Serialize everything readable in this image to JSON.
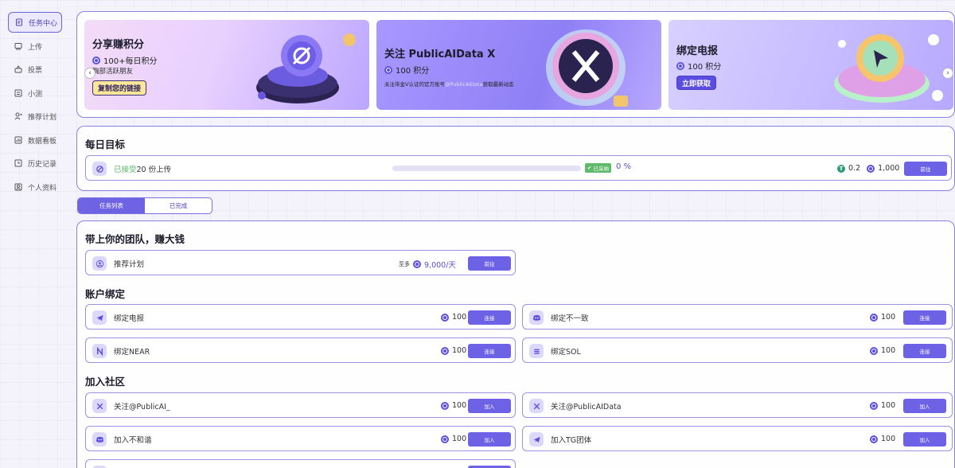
{
  "sidebar": {
    "items": [
      {
        "label": "任务中心",
        "icon": "task-center-icon",
        "active": true
      },
      {
        "label": "上传",
        "icon": "upload-icon"
      },
      {
        "label": "投票",
        "icon": "vote-icon"
      },
      {
        "label": "小测",
        "icon": "quiz-icon"
      },
      {
        "label": "推荐计划",
        "icon": "referral-icon"
      },
      {
        "label": "数据看板",
        "icon": "dashboard-icon"
      },
      {
        "label": "历史记录",
        "icon": "history-icon"
      },
      {
        "label": "个人资料",
        "icon": "profile-icon"
      }
    ]
  },
  "banners": [
    {
      "title": "分享赚积分",
      "points": "100+每日积分",
      "subtitle": "胸部活跃朋友",
      "button": "复制您的链接"
    },
    {
      "title": "关注 PublicAIData X",
      "points": "100 积分",
      "subtitle_prefix": "关注带金V认证的官方账号",
      "subtitle_handle": "@PublicAIData",
      "subtitle_suffix": "获取最新动态"
    },
    {
      "title": "绑定电报",
      "points": "100 积分",
      "button": "立即获取"
    }
  ],
  "daily": {
    "title": "每日目标",
    "task": {
      "accepted": "已接受",
      "label": "20 份上传",
      "progress_percent": 0,
      "status": "已采纳",
      "percent_text": "0 %",
      "token_amount": "0.2",
      "points": "1,000",
      "button": "前往"
    }
  },
  "tabs": [
    {
      "label": "任务列表",
      "active": true
    },
    {
      "label": "已完成",
      "active": false
    }
  ],
  "sections": {
    "team": {
      "title": "带上你的团队，赚大钱",
      "task": {
        "label": "推荐计划",
        "prefix": "至多",
        "reward": "9,000/天",
        "button": "前往"
      }
    },
    "binding": {
      "title": "账户绑定",
      "tasks": [
        {
          "label": "绑定电报",
          "reward": "100",
          "button": "连接",
          "icon": "telegram-icon"
        },
        {
          "label": "绑定不一致",
          "reward": "100",
          "button": "连接",
          "icon": "discord-icon"
        },
        {
          "label": "绑定NEAR",
          "reward": "100",
          "button": "连接",
          "icon": "near-icon"
        },
        {
          "label": "绑定SOL",
          "reward": "100",
          "button": "连接",
          "icon": "solana-icon"
        }
      ]
    },
    "community": {
      "title": "加入社区",
      "tasks": [
        {
          "label": "关注@PublicAI_",
          "reward": "100",
          "button": "加入",
          "icon": "x-icon"
        },
        {
          "label": "关注@PublicAIData",
          "reward": "100",
          "button": "加入",
          "icon": "x-icon"
        },
        {
          "label": "加入不和谐",
          "reward": "100",
          "button": "加入",
          "icon": "discord-icon"
        },
        {
          "label": "加入TG团体",
          "reward": "100",
          "button": "加入",
          "icon": "telegram-icon"
        }
      ]
    }
  },
  "colors": {
    "accent": "#6e63e3",
    "brand": "#5c4fe0",
    "success": "#5fb96a",
    "token": "#2e9b76"
  }
}
